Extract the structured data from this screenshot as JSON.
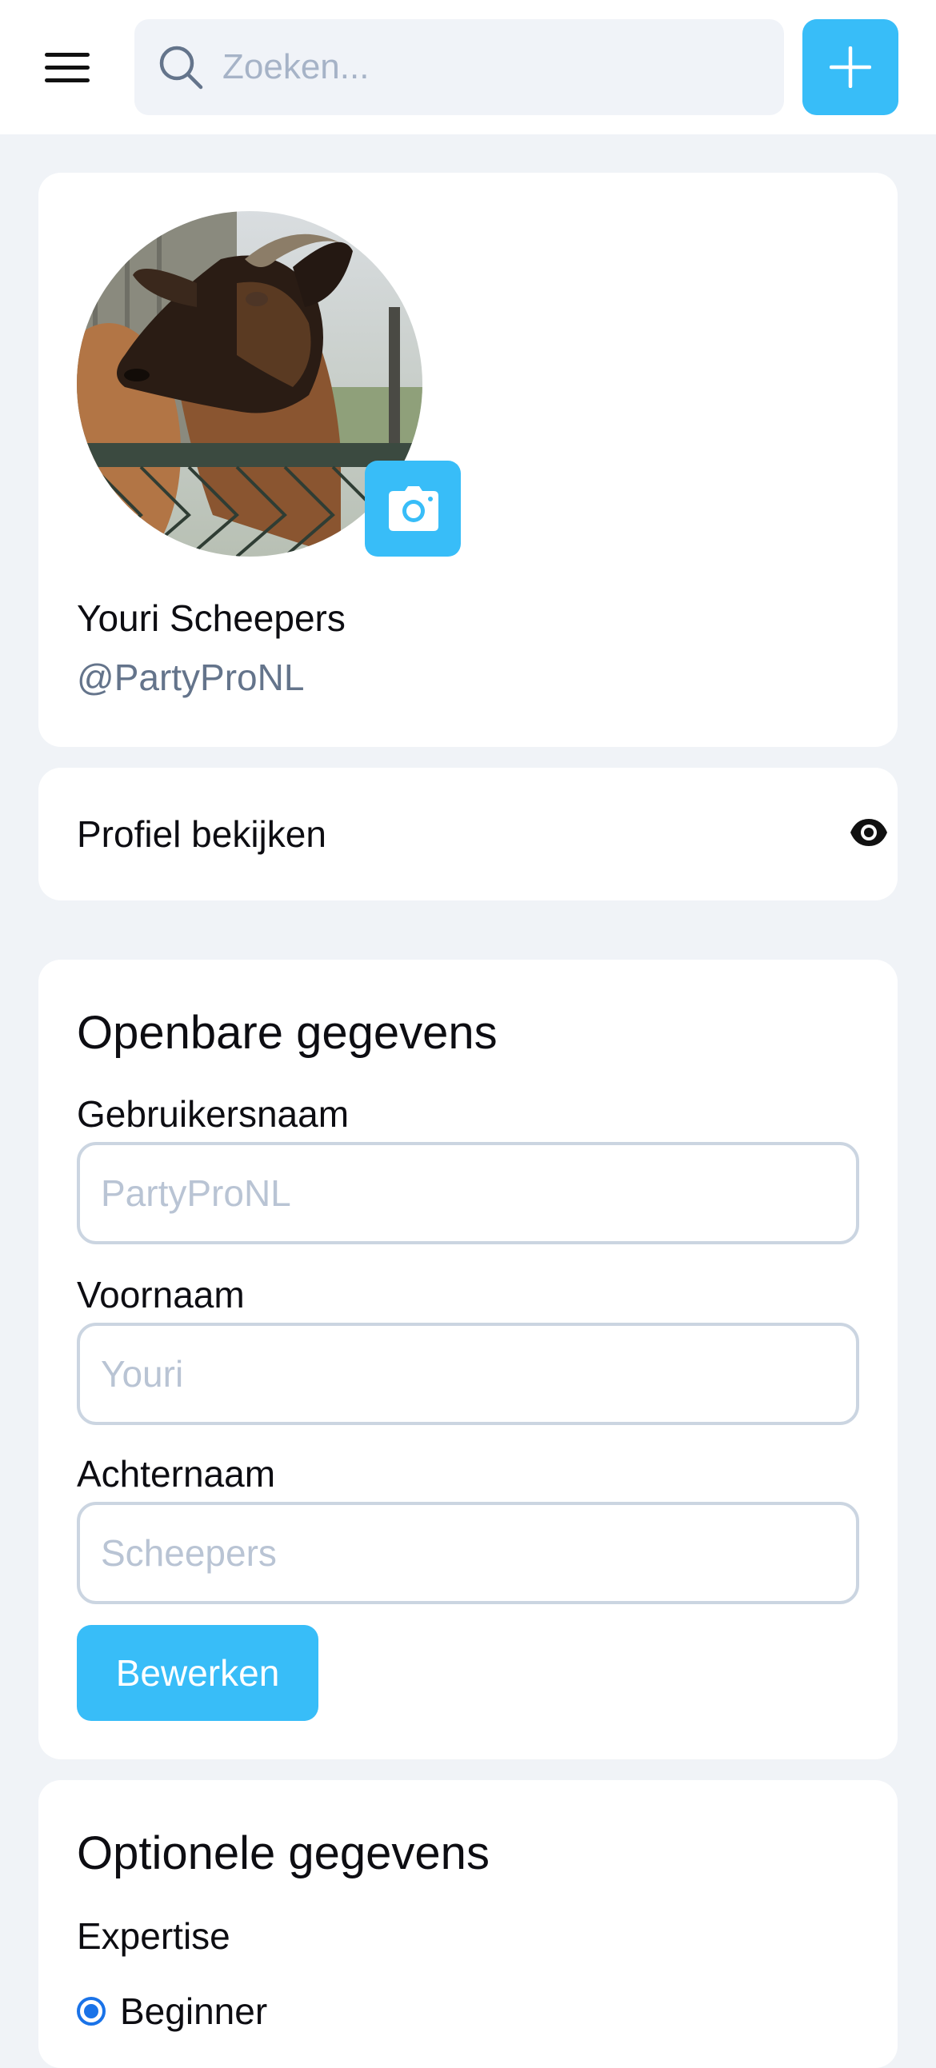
{
  "search": {
    "placeholder": "Zoeken..."
  },
  "profile": {
    "name": "Youri Scheepers",
    "handle": "@PartyProNL"
  },
  "view_profile": {
    "label": "Profiel bekijken"
  },
  "public_data": {
    "title": "Openbare gegevens",
    "fields": [
      {
        "label": "Gebruikersnaam",
        "placeholder": "PartyProNL"
      },
      {
        "label": "Voornaam",
        "placeholder": "Youri"
      },
      {
        "label": "Achternaam",
        "placeholder": "Scheepers"
      }
    ],
    "edit_label": "Bewerken"
  },
  "optional_data": {
    "title": "Optionele gegevens",
    "expertise_label": "Expertise",
    "expertise_selected": "Beginner"
  },
  "colors": {
    "accent": "#38bdf8",
    "background": "#f0f3f7",
    "radio": "#1a73e8"
  }
}
